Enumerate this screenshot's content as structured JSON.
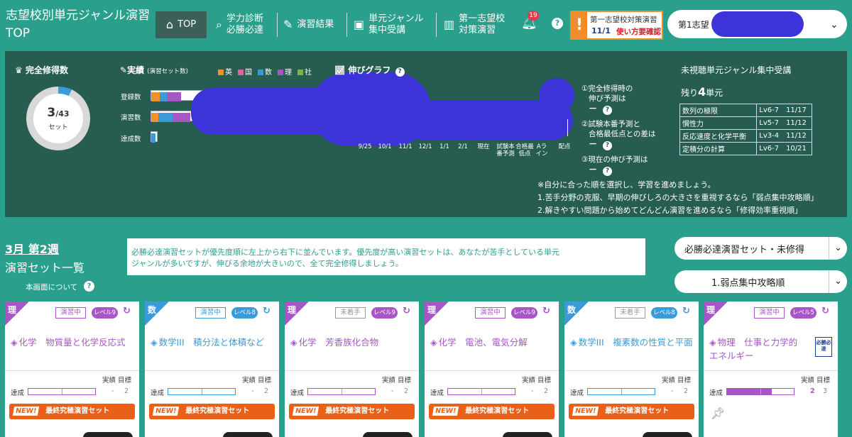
{
  "header": {
    "title": "志望校別単元ジャンル演習TOP",
    "nav": [
      {
        "icon": "home-icon",
        "label": "TOP"
      },
      {
        "icon": "search-icon",
        "label_1": "学力診断",
        "label_2": "必勝必達"
      },
      {
        "icon": "edit-icon",
        "label": "演習結果"
      },
      {
        "icon": "video-icon",
        "label_1": "単元ジャンル",
        "label_2": "集中受講"
      },
      {
        "icon": "building-icon",
        "label_1": "第一志望校",
        "label_2": "対策演習"
      }
    ],
    "notification_count": "19",
    "help": "?",
    "alert": {
      "mark": "!",
      "line1": "第一志望校対策演習",
      "date": "11/1",
      "line2": "使い方要確認"
    },
    "school_select": {
      "label": "第1志望",
      "chevron": "⌄"
    }
  },
  "panel": {
    "completion": {
      "title": "完全修得数",
      "value": "3",
      "total": "/43",
      "unit": "セット"
    },
    "results": {
      "title": "実績",
      "subtitle": "(演習セット数)",
      "legend": [
        {
          "label": "英",
          "color": "#f0922b"
        },
        {
          "label": "国",
          "color": "#e0609b"
        },
        {
          "label": "数",
          "color": "#3b9ad9"
        },
        {
          "label": "理",
          "color": "#a855c8"
        },
        {
          "label": "社",
          "color": "#7cb342"
        }
      ],
      "rows": [
        "登録数",
        "演習数",
        "達成数"
      ]
    },
    "growth": {
      "title": "伸びグラフ",
      "x_ticks": [
        "9/25",
        "10/1",
        "11/1",
        "12/1",
        "1/1",
        "2/1",
        "現在",
        "試験本番予測",
        "合格最低点",
        "Aライン",
        "配点"
      ],
      "questions": [
        {
          "text_1": "①完全修得時の",
          "text_2": "伸び予測は",
          "value": "－"
        },
        {
          "text_1": "②試験本番予測と",
          "text_2": "合格最低点との差は",
          "value": "－"
        },
        {
          "text_1": "③現在の伸び予測は",
          "text_2": "",
          "value": "－"
        }
      ]
    },
    "note": [
      "※自分に合った順を選択し、学習を進めましょう。",
      "1.苦手分野の克服、早期の伸びしろの大きさを重視するなら「弱点集中攻略順」",
      "2.解きやすい問題から始めてどんどん演習を進めるなら「修得効率重視順」"
    ],
    "unwatched": {
      "title": "未視聴単元ジャンル集中受講",
      "remaining_prefix": "残り",
      "remaining_count": "4",
      "remaining_suffix": "単元",
      "rows": [
        {
          "name": "数列の極限",
          "level": "Lv6-7",
          "date": "11/17"
        },
        {
          "name": "慣性力",
          "level": "Lv5-7",
          "date": "11/12"
        },
        {
          "name": "反応速度と化学平衡",
          "level": "Lv3-4",
          "date": "11/12"
        },
        {
          "name": "定積分の計算",
          "level": "Lv6-7",
          "date": "10/21"
        }
      ]
    }
  },
  "list": {
    "week": "3月 第2週",
    "title": "演習セット一覧",
    "about": "本画面について",
    "info_1": "必勝必達演習セットが優先度順に左上から右下に並んでいます。優先度が高い演習セットは、あなたが苦手としている単元",
    "info_2": "ジャンルが多いですが、伸びる余地が大きいので、全て完全修得しましょう。",
    "filter": "必勝必達演習セット・未修得",
    "sort": "1.弱点集中攻略順"
  },
  "cards": [
    {
      "subject": "理",
      "status": "演習中",
      "level": "レベル9",
      "title": "化学　物質量と化学反応式",
      "goal_label": "実績 目標",
      "ach_label": "達成",
      "actual": "-",
      "goal": "2",
      "new": "NEW!",
      "button": "最終究極演習セット",
      "color": "#a855c8",
      "progress": 0
    },
    {
      "subject": "数",
      "status": "演習中",
      "level": "レベル8",
      "title": "数学III　積分法と体積など",
      "goal_label": "実績 目標",
      "ach_label": "達成",
      "actual": "-",
      "goal": "2",
      "new": "NEW!",
      "button": "最終究極演習セット",
      "color": "#3b9ad9",
      "progress": 0
    },
    {
      "subject": "理",
      "status": "未着手",
      "level": "レベル9",
      "title": "化学　芳香族化合物",
      "goal_label": "実績 目標",
      "ach_label": "達成",
      "actual": "-",
      "goal": "2",
      "new": "NEW!",
      "button": "最終究極演習セット",
      "color": "#a855c8",
      "progress": 0
    },
    {
      "subject": "理",
      "status": "演習中",
      "level": "レベル9",
      "title": "化学　電池、電気分解",
      "goal_label": "実績 目標",
      "ach_label": "達成",
      "actual": "-",
      "goal": "2",
      "new": "NEW!",
      "button": "最終究極演習セット",
      "color": "#a855c8",
      "progress": 0
    },
    {
      "subject": "数",
      "status": "未着手",
      "level": "レベル8",
      "title": "数学III　複素数の性質と平面",
      "goal_label": "実績 目標",
      "ach_label": "達成",
      "actual": "-",
      "goal": "2",
      "new": "NEW!",
      "button": "最終究極演習セット",
      "color": "#3b9ad9",
      "progress": 0
    },
    {
      "subject": "理",
      "status": "演習中",
      "level": "レベル5",
      "title": "物理　仕事と力学的エネルギー",
      "goal_label": "実績 目標",
      "ach_label": "達成",
      "actual": "2",
      "goal": "3",
      "badge": "必勝必達",
      "color": "#a855c8",
      "progress": 0.667
    }
  ]
}
